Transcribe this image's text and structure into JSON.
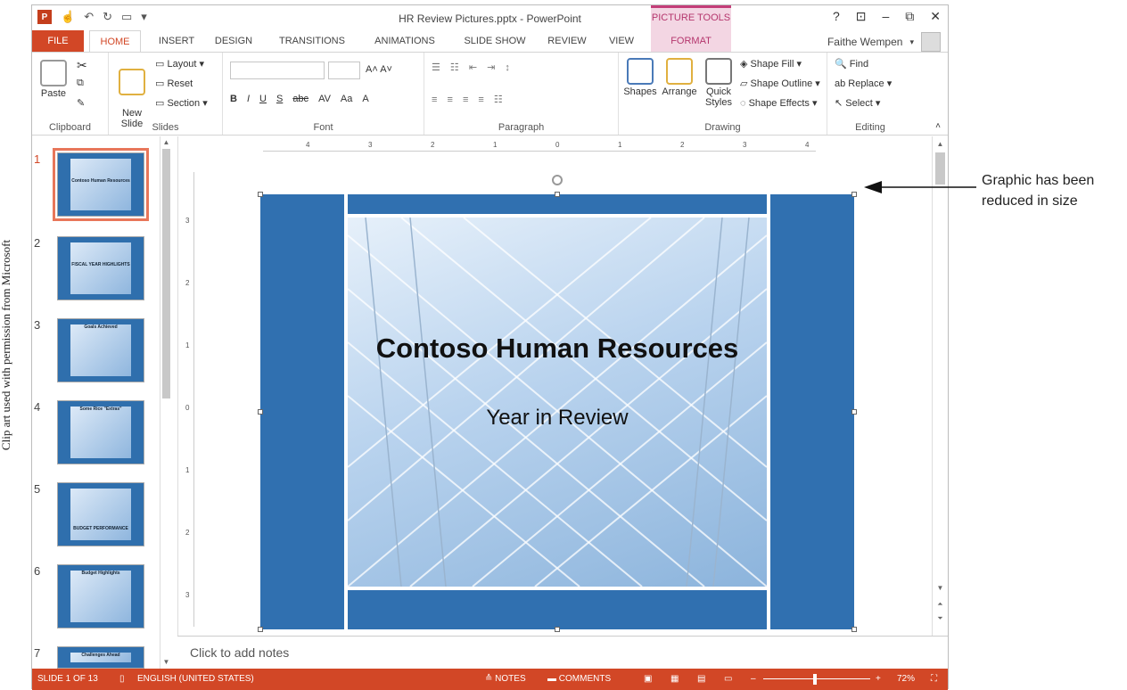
{
  "credit": "Clip art used with permission from Microsoft",
  "callout": {
    "line1": "Graphic has been",
    "line2": "reduced in size"
  },
  "window": {
    "title": "HR Review Pictures.pptx - PowerPoint",
    "picture_tools": "PICTURE TOOLS",
    "controls": [
      "?",
      "⊡",
      "–",
      "⧉",
      "✕"
    ]
  },
  "tabs": [
    "FILE",
    "HOME",
    "INSERT",
    "DESIGN",
    "TRANSITIONS",
    "ANIMATIONS",
    "SLIDE SHOW",
    "REVIEW",
    "VIEW",
    "FORMAT"
  ],
  "user": "Faithe Wempen",
  "ribbon": {
    "clipboard": {
      "paste": "Paste",
      "label": "Clipboard"
    },
    "slides": {
      "new_slide": "New\nSlide",
      "layout": "Layout",
      "reset": "Reset",
      "section": "Section",
      "label": "Slides"
    },
    "font": {
      "bold": "B",
      "italic": "I",
      "underline": "U",
      "shadow": "S",
      "strike": "abc",
      "spacing": "AV",
      "case": "Aa",
      "label": "Font"
    },
    "paragraph": {
      "label": "Paragraph"
    },
    "drawing": {
      "shapes": "Shapes",
      "arrange": "Arrange",
      "quick_styles": "Quick Styles",
      "shape_fill": "Shape Fill",
      "shape_outline": "Shape Outline",
      "shape_effects": "Shape Effects",
      "label": "Drawing"
    },
    "editing": {
      "find": "Find",
      "replace": "Replace",
      "select": "Select",
      "label": "Editing"
    }
  },
  "thumbnails": [
    {
      "num": "1",
      "text": "Contoso Human Resources"
    },
    {
      "num": "2",
      "text": "FISCAL YEAR HIGHLIGHTS"
    },
    {
      "num": "3",
      "text": "Goals Achieved"
    },
    {
      "num": "4",
      "text": "Some Rice \"Extras\""
    },
    {
      "num": "5",
      "text": "BUDGET PERFORMANCE"
    },
    {
      "num": "6",
      "text": "Budget Highlights"
    },
    {
      "num": "7",
      "text": "Challenges Ahead"
    }
  ],
  "ruler_h": [
    "4",
    "3",
    "2",
    "1",
    "0",
    "1",
    "2",
    "3",
    "4"
  ],
  "ruler_v": [
    "3",
    "2",
    "1",
    "0",
    "1",
    "2",
    "3"
  ],
  "slide": {
    "title": "Contoso Human Resources",
    "subtitle": "Year in Review"
  },
  "notes_placeholder": "Click to add notes",
  "status": {
    "slide": "SLIDE 1 OF 13",
    "language": "ENGLISH (UNITED STATES)",
    "notes": "NOTES",
    "comments": "COMMENTS",
    "zoom": "72%"
  },
  "colors": {
    "accent": "#d24726",
    "slide_blue": "#3070b0",
    "picture_tools": "#b5366d"
  }
}
